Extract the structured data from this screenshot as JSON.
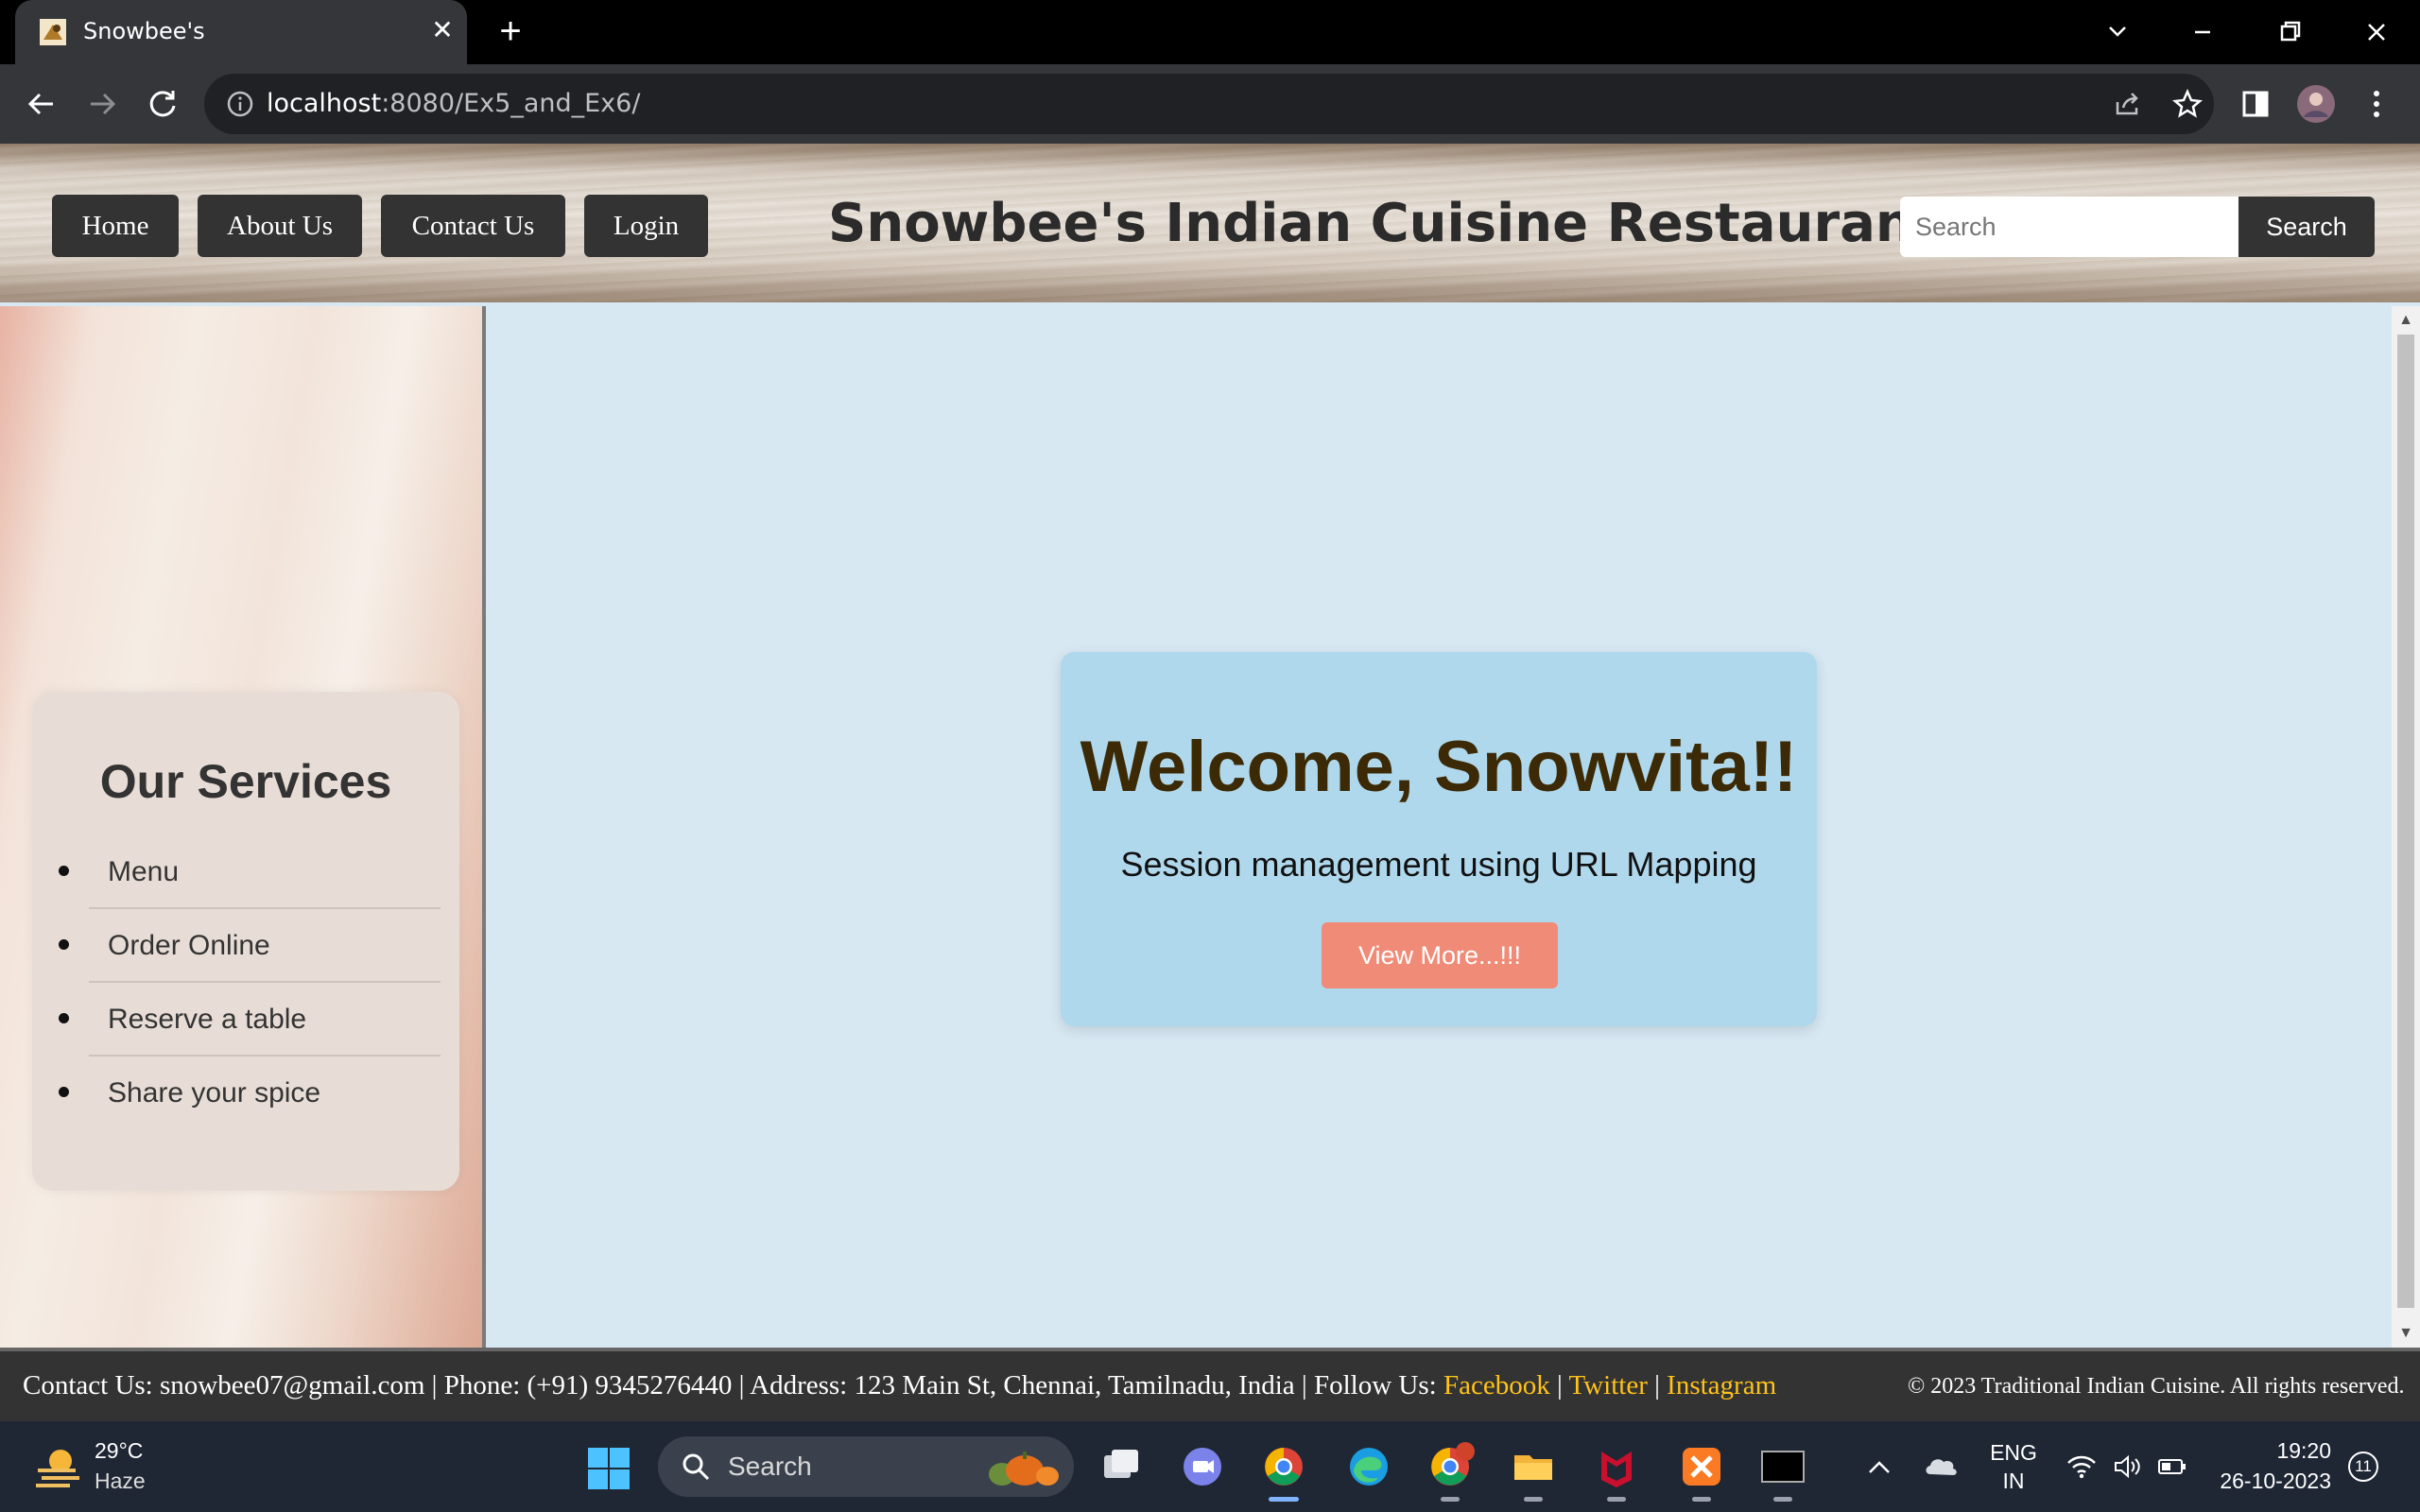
{
  "browser": {
    "tab_title": "Snowbee's",
    "url_host": "localhost",
    "url_path": ":8080/Ex5_and_Ex6/"
  },
  "header": {
    "nav": [
      "Home",
      "About Us",
      "Contact Us",
      "Login"
    ],
    "title": "Snowbee's Indian Cuisine Restaurant",
    "search_placeholder": "Search",
    "search_button": "Search"
  },
  "sidebar": {
    "title": "Our Services",
    "items": [
      "Menu",
      "Order Online",
      "Reserve a table",
      "Share your spice"
    ]
  },
  "welcome": {
    "title": "Welcome, Snowvita!!",
    "subtitle": "Session management using URL Mapping",
    "button": "View More...!!!"
  },
  "footer": {
    "contact_prefix": "Contact Us: snowbee07@gmail.com | Phone: (+91) 9345276440 | Address: 123 Main St, Chennai, Tamilnadu, India | Follow Us: ",
    "links": [
      "Facebook",
      "Twitter",
      "Instagram"
    ],
    "separator": " | ",
    "copyright": "© 2023 Traditional Indian Cuisine. All rights reserved."
  },
  "taskbar": {
    "weather_temp": "29°C",
    "weather_cond": "Haze",
    "search_label": "Search",
    "lang_1": "ENG",
    "lang_2": "IN",
    "time": "19:20",
    "date": "26-10-2023",
    "notification_count": "11"
  },
  "colors": {
    "nav_bg": "#333333",
    "page_bg": "#d7e8f3",
    "welcome_card": "#b0d8ec",
    "welcome_title": "#3b2a05",
    "view_button": "#f08b77",
    "footer_link": "#ffc21a"
  }
}
